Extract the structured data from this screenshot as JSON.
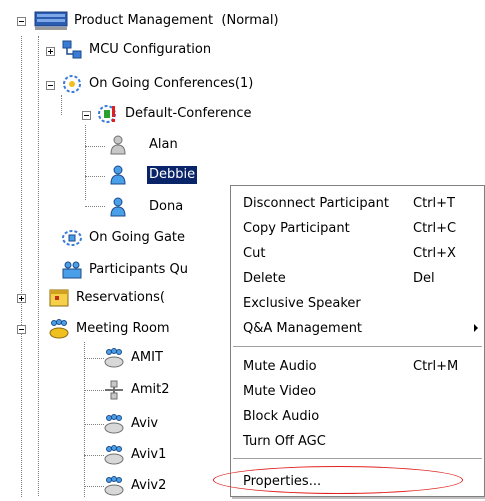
{
  "tree": {
    "root": "Product Management  (Normal)",
    "mcu_configuration": "MCU Configuration",
    "ongoing_conferences": "On Going Conferences(1)",
    "default_conference": "Default-Conference",
    "participants": [
      "Alan",
      "Debbie",
      "Dona"
    ],
    "ongoing_gate": "On Going Gate",
    "participants_queue": "Participants Qu",
    "reservations": "Reservations(",
    "meeting_rooms": "Meeting Room",
    "rooms": [
      "AMIT",
      "Amit2",
      "Aviv",
      "Aviv1",
      "Aviv2"
    ]
  },
  "context_menu": {
    "items": [
      {
        "label": "Disconnect Participant",
        "shortcut": "Ctrl+T"
      },
      {
        "label": "Copy Participant",
        "shortcut": "Ctrl+C"
      },
      {
        "label": "Cut",
        "shortcut": "Ctrl+X"
      },
      {
        "label": "Delete",
        "shortcut": "Del"
      },
      {
        "label": "Exclusive Speaker",
        "shortcut": ""
      },
      {
        "label": "Q&A Management",
        "shortcut": ""
      },
      {
        "label": "Mute Audio",
        "shortcut": "Ctrl+M"
      },
      {
        "label": "Mute Video",
        "shortcut": ""
      },
      {
        "label": "Block Audio",
        "shortcut": ""
      },
      {
        "label": "Turn Off AGC",
        "shortcut": ""
      },
      {
        "label": "Properties...",
        "shortcut": ""
      }
    ]
  },
  "colors": {
    "selection": "#0a246a",
    "highlight_oval": "#e02020"
  }
}
